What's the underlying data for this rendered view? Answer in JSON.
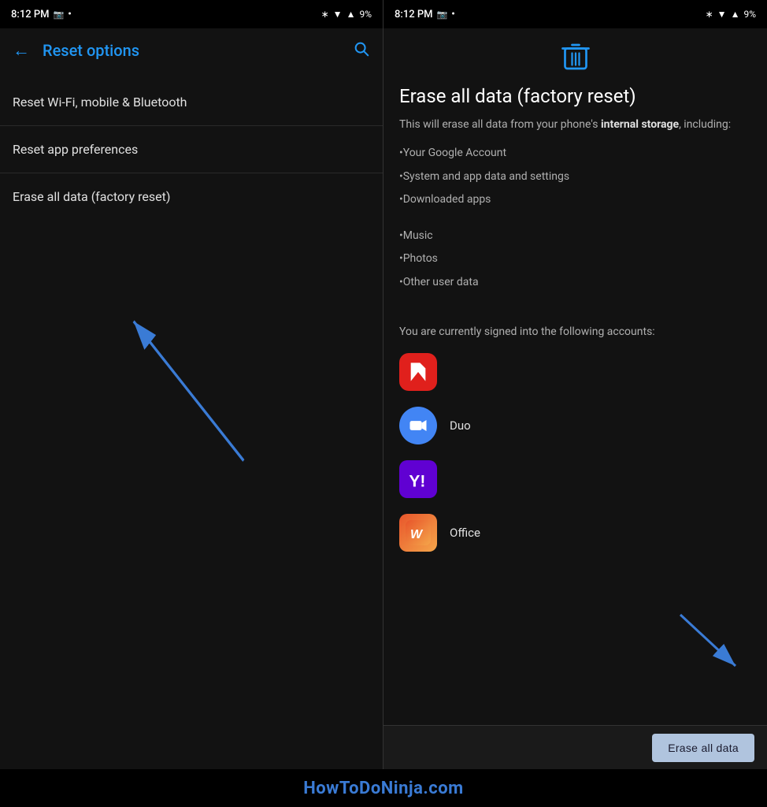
{
  "left": {
    "status": {
      "time": "8:12 PM",
      "battery": "9%"
    },
    "header": {
      "back_label": "←",
      "title": "Reset options",
      "search_icon": "🔍"
    },
    "menu_items": [
      {
        "id": "wifi",
        "label": "Reset Wi-Fi, mobile & Bluetooth"
      },
      {
        "id": "app-prefs",
        "label": "Reset app preferences"
      },
      {
        "id": "factory",
        "label": "Erase all data (factory reset)"
      }
    ]
  },
  "right": {
    "status": {
      "time": "8:12 PM",
      "battery": "9%"
    },
    "content": {
      "icon": "🗑",
      "title": "Erase all data (factory reset)",
      "description_plain": "This will erase all data from your phone's ",
      "description_bold": "internal storage",
      "description_suffix": ", including:",
      "bullets": [
        "•Your Google Account",
        "•System and app data and settings",
        "•Downloaded apps",
        "•Music",
        "•Photos",
        "•Other user data"
      ],
      "accounts_text": "You are currently signed into the following accounts:",
      "accounts": [
        {
          "id": "adobe",
          "type": "adobe",
          "label": ""
        },
        {
          "id": "duo",
          "type": "duo",
          "label": "Duo"
        },
        {
          "id": "yahoo",
          "type": "yahoo",
          "label": ""
        },
        {
          "id": "office",
          "type": "office",
          "label": "Office"
        }
      ],
      "erase_button": "Erase all data"
    }
  },
  "footer": {
    "watermark": "HowToDoNinja.com"
  }
}
